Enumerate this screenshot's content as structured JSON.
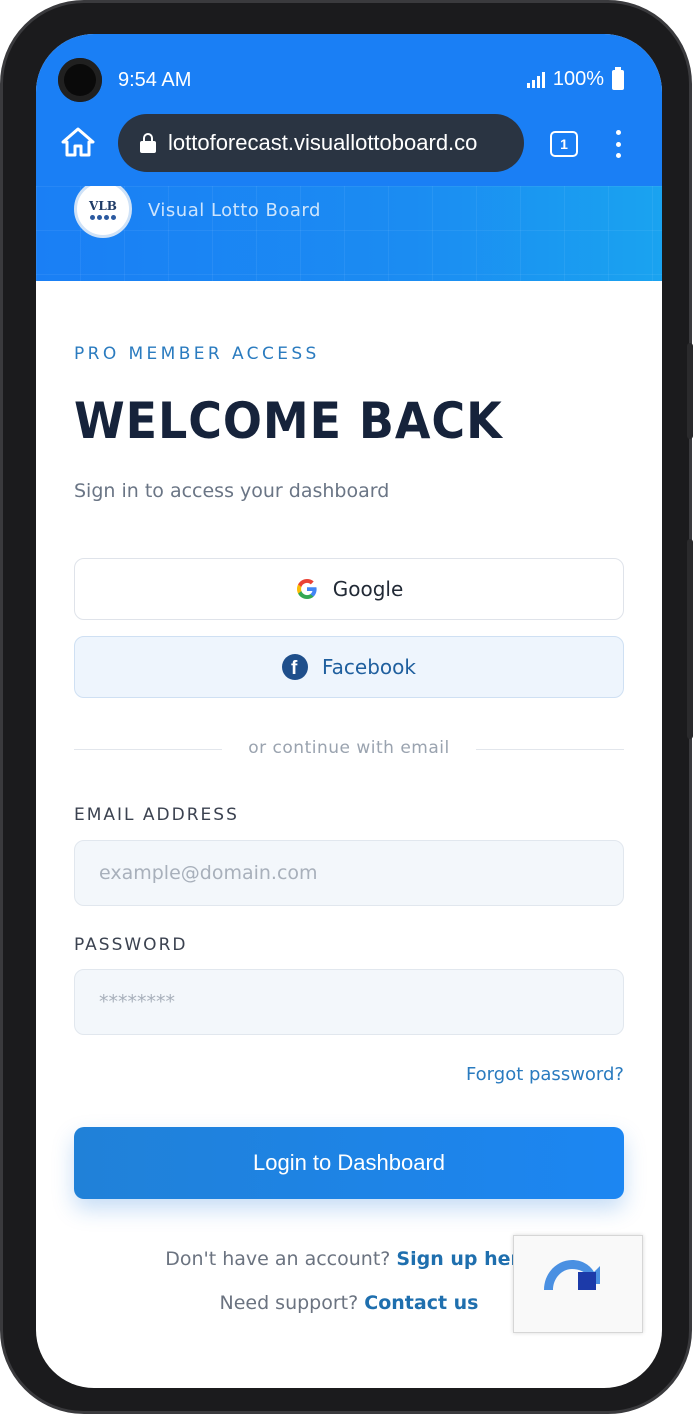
{
  "status_bar": {
    "time": "9:54 AM",
    "battery": "100%"
  },
  "browser": {
    "url": "lottoforecast.visuallottoboard.co",
    "tab_count": "1"
  },
  "site": {
    "logo_text": "VLB",
    "name": "Visual Lotto Board"
  },
  "login": {
    "eyebrow": "PRO MEMBER ACCESS",
    "title": "WELCOME BACK",
    "subtitle": "Sign in to access your dashboard",
    "google_label": "Google",
    "facebook_label": "Facebook",
    "divider_text": "or continue with email",
    "email_label": "EMAIL ADDRESS",
    "email_placeholder": "example@domain.com",
    "password_label": "PASSWORD",
    "password_placeholder": "********",
    "forgot_label": "Forgot password?",
    "submit_label": "Login to Dashboard",
    "signup_prompt": "Don't have an account?",
    "signup_link": "Sign up here",
    "support_prompt": "Need support?",
    "support_link": "Contact us"
  },
  "colors": {
    "brand_blue": "#1a7ff5",
    "title_navy": "#16233b",
    "link_blue": "#1f6fae"
  }
}
